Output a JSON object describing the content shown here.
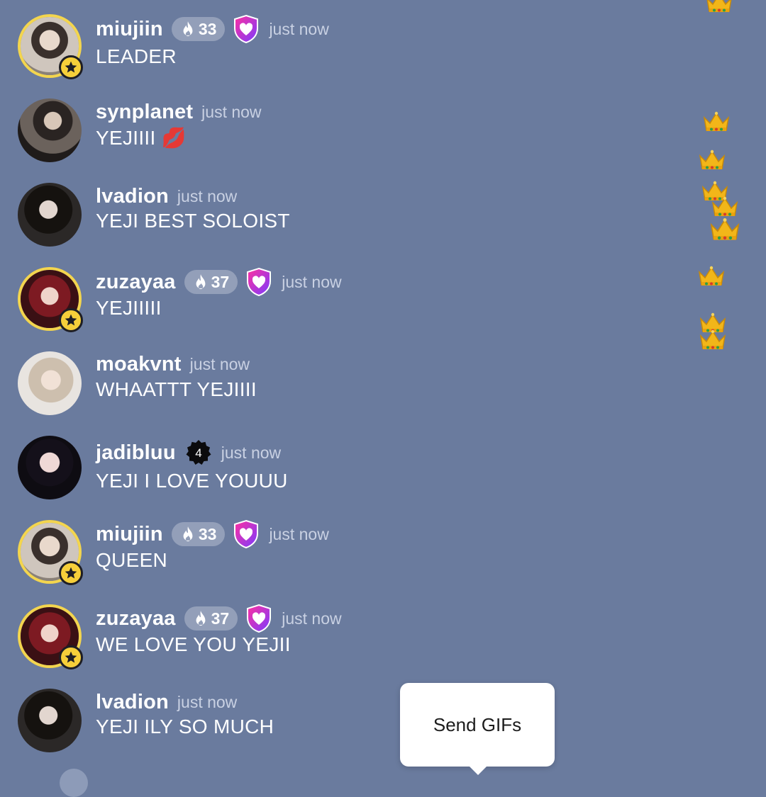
{
  "messages": [
    {
      "username": "miujiin",
      "streak": "33",
      "badge": "heart-shield",
      "time": "just now",
      "text": "LEADER",
      "avatar_style": "ring-star"
    },
    {
      "username": "synplanet",
      "time": "just now",
      "text": "YEJIIII 💋",
      "avatar_style": "plain"
    },
    {
      "username": "lvadion",
      "time": "just now",
      "text": "YEJI BEST SOLOIST",
      "avatar_style": "plain"
    },
    {
      "username": "zuzayaa",
      "streak": "37",
      "badge": "heart-shield",
      "time": "just now",
      "text": "YEJIIIII",
      "avatar_style": "ring-star"
    },
    {
      "username": "moakvnt",
      "time": "just now",
      "text": "WHAATTT YEJIIII",
      "avatar_style": "plain"
    },
    {
      "username": "jadibluu",
      "badge": "verified-4",
      "badge_text": "4",
      "time": "just now",
      "text": "YEJI I LOVE YOUUU",
      "avatar_style": "plain"
    },
    {
      "username": "miujiin",
      "streak": "33",
      "badge": "heart-shield",
      "time": "just now",
      "text": "QUEEN",
      "avatar_style": "ring-star"
    },
    {
      "username": "zuzayaa",
      "streak": "37",
      "badge": "heart-shield",
      "time": "just now",
      "text": "WE LOVE YOU YEJII",
      "avatar_style": "ring-star"
    },
    {
      "username": "lvadion",
      "time": "just now",
      "text": "YEJI ILY SO MUCH",
      "avatar_style": "plain"
    }
  ],
  "tooltip": {
    "label": "Send GIFs"
  },
  "reactions": {
    "icon": "crown-emoji"
  },
  "colors": {
    "background": "#6a7b9e",
    "ring": "#f3d54e",
    "time_text": "#c9d1e3",
    "shield_gradient_start": "#ff2fa0",
    "shield_gradient_end": "#7a3cff"
  }
}
